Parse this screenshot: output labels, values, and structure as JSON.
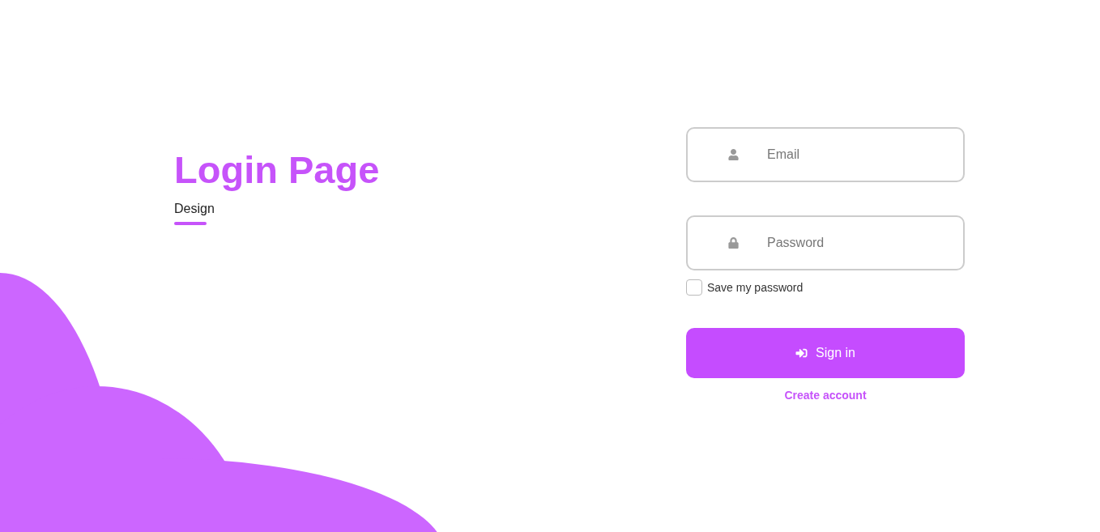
{
  "heading": {
    "title": "Login Page",
    "subtitle": "Design"
  },
  "form": {
    "fields": [
      {
        "kind": "email",
        "placeholder": "Email"
      },
      {
        "kind": "password",
        "placeholder": "Password"
      }
    ],
    "remember": {
      "label": "Save my password",
      "checked": false
    },
    "submit": {
      "label": "Sign in"
    },
    "link": "Create account"
  }
}
